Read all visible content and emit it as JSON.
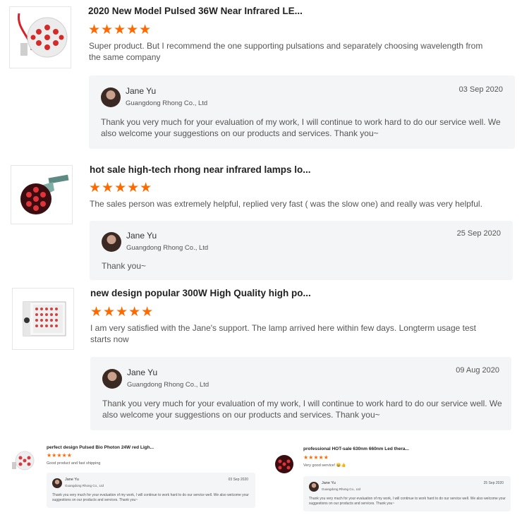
{
  "reviews": [
    {
      "product_title": "2020 New Model Pulsed 36W Near Infrared LE...",
      "stars": "★★★★★",
      "comment": "Super product. But I recommend the one supporting pulsations and separately choosing wavelength from the same company",
      "reply": {
        "name": "Jane Yu",
        "company": "Guangdong Rhong Co., Ltd",
        "date": "03 Sep 2020",
        "text": "Thank you very much for your evaluation of my work, I will continue to work hard to do our service well. We also welcome your suggestions on our products and services. Thank you~"
      }
    },
    {
      "product_title": "hot sale high-tech rhong near infrared lamps lo...",
      "stars": "★★★★★",
      "comment": "The sales person was extremely helpful, replied very fast ( was the slow one) and really was very helpful.",
      "reply": {
        "name": "Jane Yu",
        "company": "Guangdong Rhong Co., Ltd",
        "date": "25 Sep 2020",
        "text": "Thank you~"
      }
    },
    {
      "product_title": "new design popular 300W High Quality high po...",
      "stars": "★★★★★",
      "comment": "I am very satisfied with the Jane's support. The lamp arrived here within few days. Longterm usage test starts now",
      "reply": {
        "name": "Jane Yu",
        "company": "Guangdong Rhong Co., Ltd",
        "date": "09 Aug 2020",
        "text": "Thank you very much for your evaluation of my work, I will continue to work hard to do our service well. We also welcome your suggestions on our products and services. Thank you~"
      }
    },
    {
      "product_title": "perfect design Pulsed Bio Photon 24W red Ligh...",
      "stars": "★★★★★",
      "comment": "Good product and fast shipping",
      "reply": {
        "name": "Jane Yu",
        "company": "Guangdong Rhong Co., Ltd",
        "date": "03 Sep 2020",
        "text": "Thank you very much for your evaluation of my work, I will continue to work hard to do our service well. We also welcome your suggestions on our products and services. Thank you~"
      }
    },
    {
      "product_title": "professional HOT-sale 630nm 660nm Led thera...",
      "stars": "★★★★★",
      "comment": "Very good service! 😀👍",
      "reply": {
        "name": "Jane Yu",
        "company": "Guangdong Rhong Co., Ltd",
        "date": "25 Sep 2020",
        "text": "Thank you very much for your evaluation of my work, I will continue to work hard to do our service well. We also welcome your suggestions on our products and services. Thank you~"
      }
    }
  ],
  "colors": {
    "star": "#ff6a00",
    "reply_bg": "#f4f5f7"
  }
}
